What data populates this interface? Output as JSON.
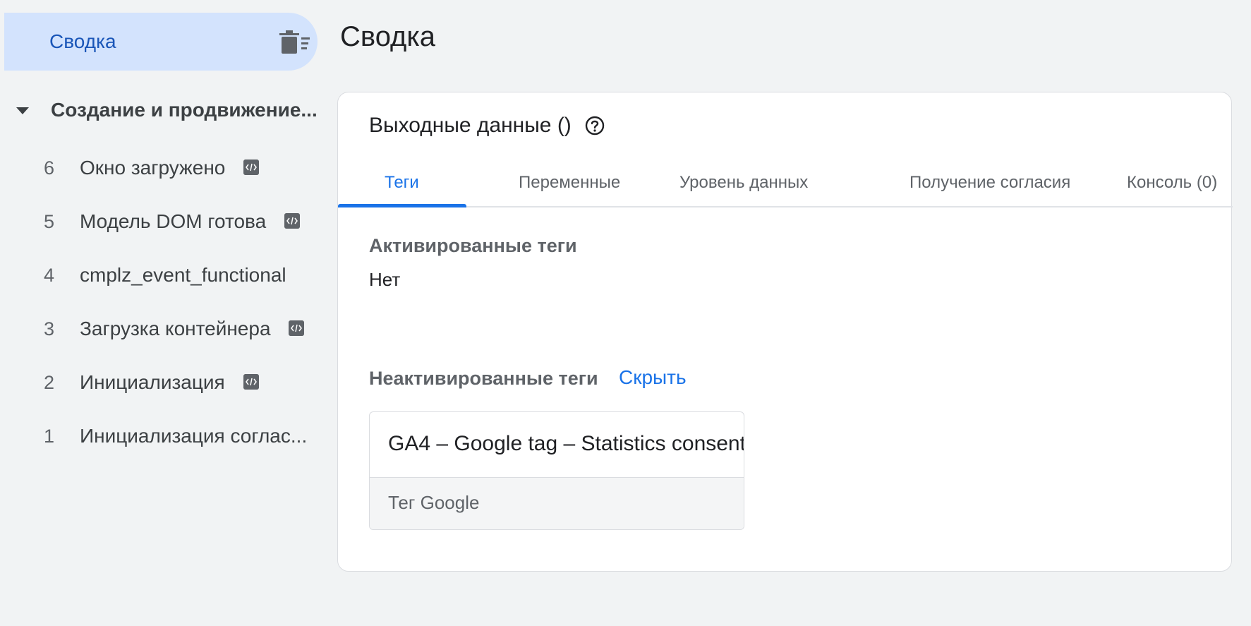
{
  "sidebar": {
    "summary_label": "Сводка",
    "group_label": "Создание и продвижение...",
    "events": [
      {
        "num": "6",
        "name": "Окно загружено",
        "has_code_icon": true
      },
      {
        "num": "5",
        "name": "Модель DOM готова",
        "has_code_icon": true
      },
      {
        "num": "4",
        "name": "cmplz_event_functional",
        "has_code_icon": false
      },
      {
        "num": "3",
        "name": "Загрузка контейнера",
        "has_code_icon": true
      },
      {
        "num": "2",
        "name": "Инициализация",
        "has_code_icon": true
      },
      {
        "num": "1",
        "name": "Инициализация соглас...",
        "has_code_icon": false
      }
    ]
  },
  "main": {
    "page_title": "Сводка",
    "card_title": "Выходные данные ()",
    "tabs": [
      {
        "label": "Теги",
        "active": true
      },
      {
        "label": "Переменные",
        "active": false
      },
      {
        "label": "Уровень данных",
        "active": false
      },
      {
        "label": "Получение согласия",
        "active": false
      },
      {
        "label": "Консоль (0)",
        "active": false
      }
    ],
    "fired_label": "Активированные теги",
    "fired_value": "Нет",
    "not_fired_label": "Неактивированные теги",
    "hide_link": "Скрыть",
    "tag": {
      "name": "GA4 – Google tag – Statistics consent",
      "type": "Тег Google"
    }
  },
  "colors": {
    "accent": "#1a73e8",
    "selected_bg": "#d3e3fd",
    "page_bg": "#f1f3f4"
  },
  "icons": {
    "clear": "clear-all-icon",
    "caret": "caret-down-icon",
    "help": "help-circle-icon",
    "code": "code-tag-icon"
  }
}
